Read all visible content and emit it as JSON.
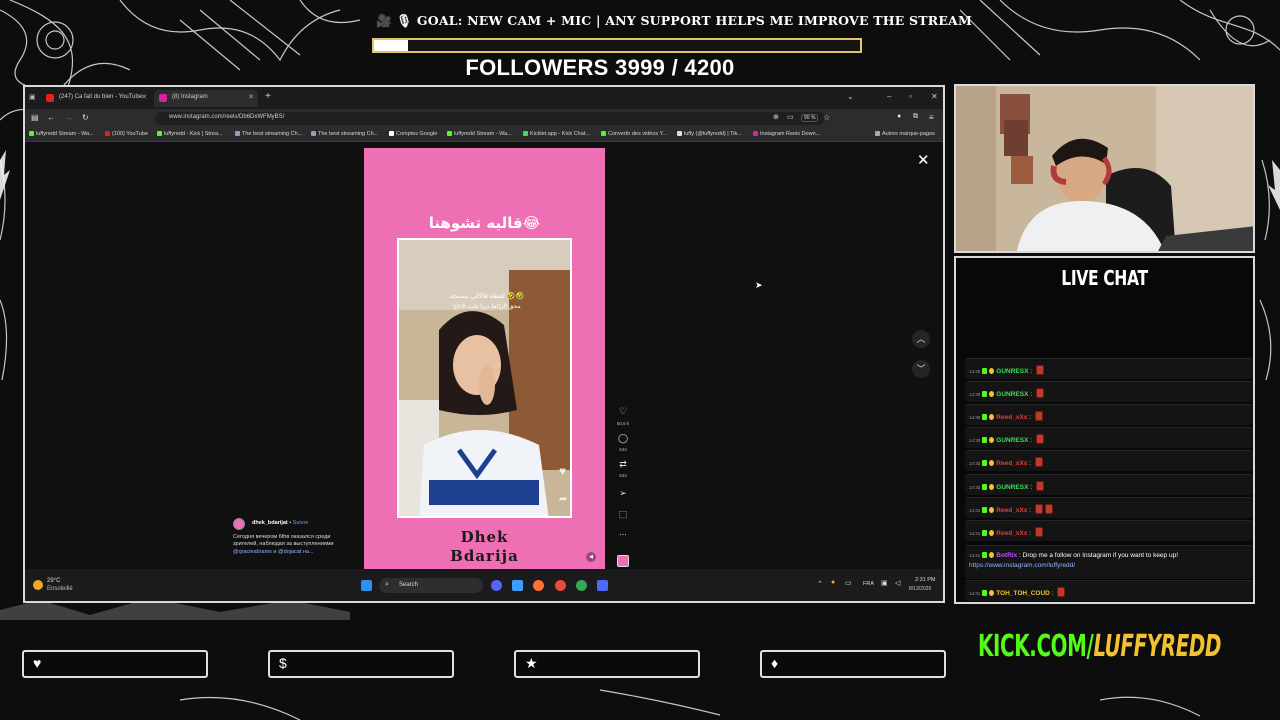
{
  "overlay": {
    "goal_text": "🎥 🎙 GOAL: NEW CAM + MIC | ANY SUPPORT HELPS ME IMPROVE THE STREAM",
    "goal_progress": 0.07,
    "followers_text": "FOLLOWERS 3999 / 4200",
    "live_chat_title": "LIVE CHAT",
    "kick_prefix": "KICK.COM/",
    "kick_handle": "LUFFYREDD",
    "accent_color": "#e3c46a",
    "kick_green": "#53fc18",
    "kick_yellow": "#f2c230",
    "panel_icons": [
      "heart-icon",
      "dollar-icon",
      "star-icon",
      "diamond-icon"
    ]
  },
  "browser": {
    "tabs": [
      {
        "label": "(247) Ca fait du bien - YouTube",
        "icon": "youtube-icon",
        "active": false
      },
      {
        "label": "(8) Instagram",
        "icon": "instagram-icon",
        "active": true
      }
    ],
    "new_tab": "+",
    "url": "www.instagram.com/reels/Db6DxWFMyBS/",
    "zoom": "90 %",
    "bookmarks": [
      "luffyredd Stream - Wa...",
      "(100) YouTube",
      "luffyredd - Kick | Strea...",
      "The best streaming Ch...",
      "The best streaming Ch...",
      "Comptes Google",
      "luffyredd Stream - Wa...",
      "Kicklet.app - Kick Chat...",
      "Convertir des vidéos Y...",
      "luffy (@luffyredd) | Tik...",
      "Instagram Reels Down..."
    ],
    "bookmarks_other": "Autres marque-pages"
  },
  "reel": {
    "title_arabic": "قاليه تشوهنا😂",
    "caption_line1": "لقطة فالالي بسنحة 🤣🤣",
    "caption_line2": "محق الرالط درنا بايت الاتاج",
    "brand_line1": "Dhek",
    "brand_line2": "Bdarija",
    "likes": "50,6 k",
    "comments": "543",
    "reposts": "543",
    "more": "...",
    "author": "dhek_bdarijat",
    "follow": "Suivre",
    "description": "Сегодня вечером 6thв оказался среди зрителей, наблюдая за выступлениями",
    "mentions": "@qracieabrams и @dojacat на..."
  },
  "taskbar": {
    "temp": "29°C",
    "weather": "Ensoleillé",
    "search": "Search",
    "lang": "FRA",
    "time": "2:31 PM",
    "date": "8/13/2026"
  },
  "chat": {
    "messages": [
      {
        "time": "14:30",
        "user": "GUNRESX",
        "color": "#3ddc5a",
        "text": ""
      },
      {
        "time": "14:30",
        "user": "GUNRESX",
        "color": "#3ddc5a",
        "text": ""
      },
      {
        "time": "14:30",
        "user": "Reed_xXx",
        "color": "#e0403a",
        "text": ""
      },
      {
        "time": "14:30",
        "user": "GUNRESX",
        "color": "#3ddc5a",
        "text": ""
      },
      {
        "time": "14:30",
        "user": "Reed_xXx",
        "color": "#e0403a",
        "text": ""
      },
      {
        "time": "14:30",
        "user": "GUNRESX",
        "color": "#3ddc5a",
        "text": ""
      },
      {
        "time": "14:31",
        "user": "Reed_xXx",
        "color": "#e0403a",
        "text": ""
      },
      {
        "time": "14:31",
        "user": "Reed_xXx",
        "color": "#e0403a",
        "text": ""
      },
      {
        "time": "14:31",
        "user": "BotRix",
        "color": "#c04bff",
        "text": "Drop me a follow on Instagram if you want to keep up!",
        "link": "https://www.instagram.com/luffyredd/"
      },
      {
        "time": "14:31",
        "user": "TOH_TOH_COUD",
        "color": "#f2c230",
        "text": ""
      }
    ]
  }
}
